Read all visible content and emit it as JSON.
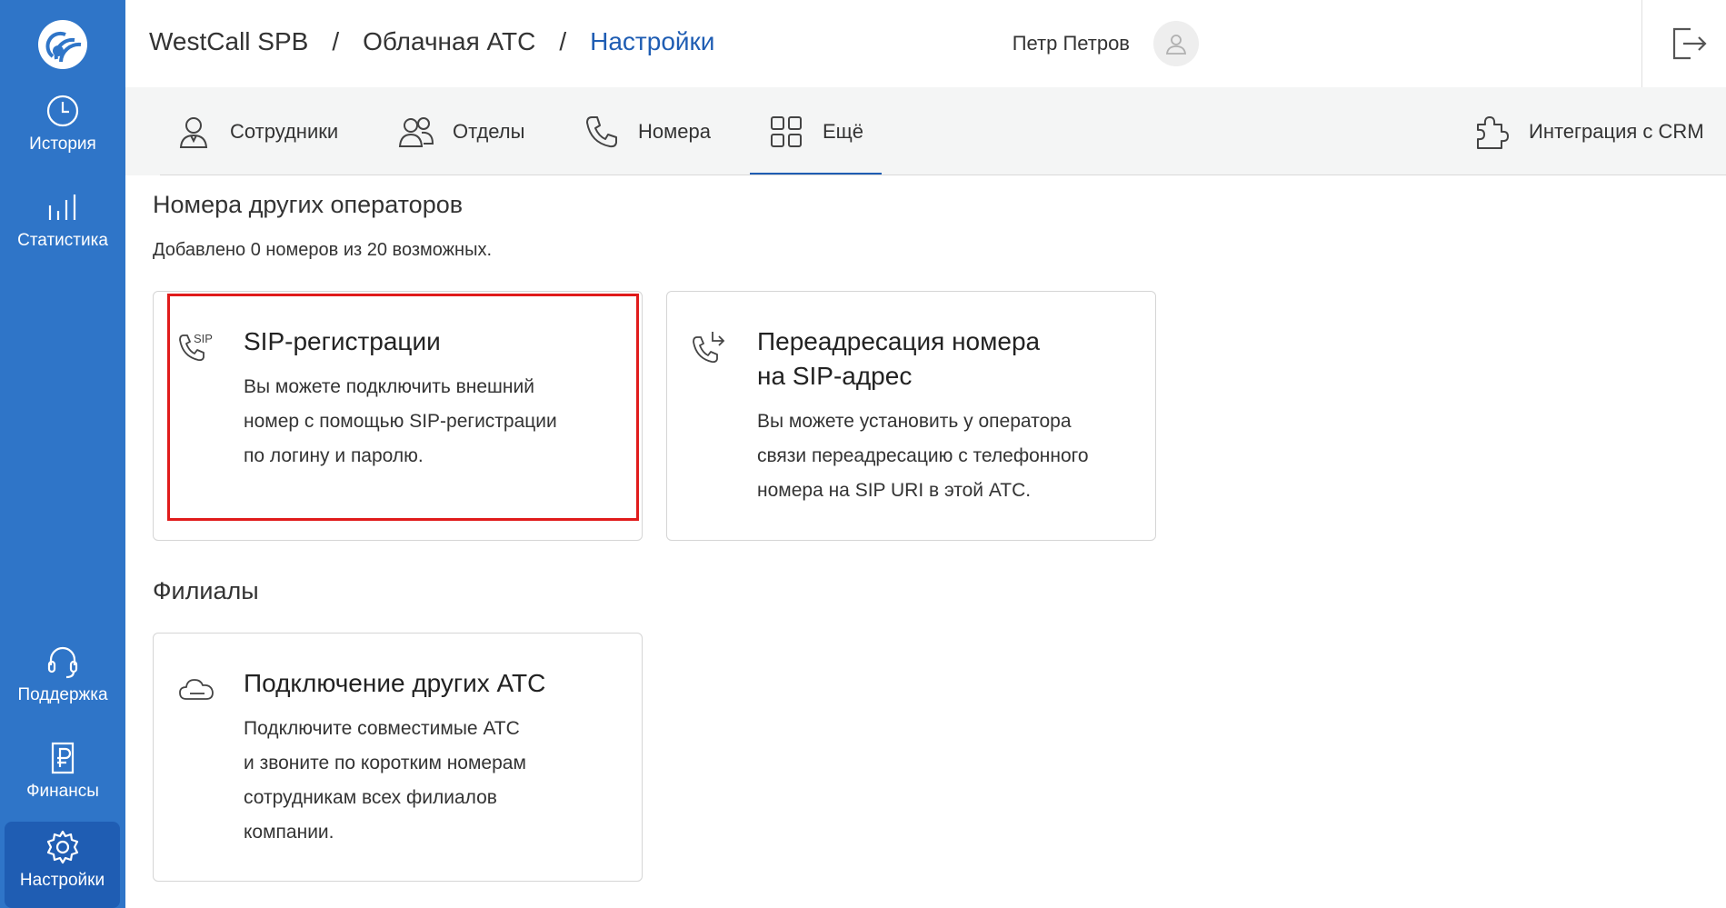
{
  "sidebar": {
    "items": [
      {
        "label": "История",
        "icon": "clock-icon"
      },
      {
        "label": "Статистика",
        "icon": "bar-chart-icon"
      },
      {
        "label": "Поддержка",
        "icon": "headset-icon"
      },
      {
        "label": "Финансы",
        "icon": "ruble-document-icon"
      },
      {
        "label": "Настройки",
        "icon": "gear-icon"
      }
    ],
    "active": "Настройки"
  },
  "header": {
    "breadcrumbs": [
      "WestCall SPB",
      "Облачная АТС",
      "Настройки"
    ],
    "separator": "/",
    "user_name": "Петр Петров"
  },
  "tabs": [
    {
      "label": "Сотрудники",
      "icon": "user-icon"
    },
    {
      "label": "Отделы",
      "icon": "users-icon"
    },
    {
      "label": "Номера",
      "icon": "phone-icon"
    },
    {
      "label": "Ещё",
      "icon": "grid-icon",
      "active": true
    },
    {
      "label": "Интеграция с CRM",
      "icon": "puzzle-icon"
    }
  ],
  "sections": {
    "operators": {
      "title": "Номера других операторов",
      "subtitle": "Добавлено 0 номеров из 20 возможных.",
      "cards": [
        {
          "title": "SIP-регистрации",
          "description": [
            "Вы можете подключить внешний",
            "номер с помощью SIP-регистрации",
            "по логину и паролю."
          ],
          "icon": "sip-phone-icon"
        },
        {
          "title": [
            "Переадресация номера",
            "на SIP-адрес"
          ],
          "description": [
            "Вы можете установить у оператора",
            "связи переадресацию с телефонного",
            "номера на SIP URI в этой АТС."
          ],
          "icon": "phone-forward-icon"
        }
      ]
    },
    "branches": {
      "title": "Филиалы",
      "cards": [
        {
          "title": "Подключение других АТС",
          "description": [
            "Подключите совместимые АТС",
            "и звоните по коротким номерам",
            "сотрудникам всех филиалов",
            "компании."
          ],
          "icon": "cloud-icon"
        }
      ]
    }
  },
  "sip_icon_text": "SIP",
  "colors": {
    "sidebar": "#2f75c8",
    "accent": "#1f5db3",
    "highlight": "#e01b1b",
    "tabs_bg": "#f4f5f5"
  }
}
